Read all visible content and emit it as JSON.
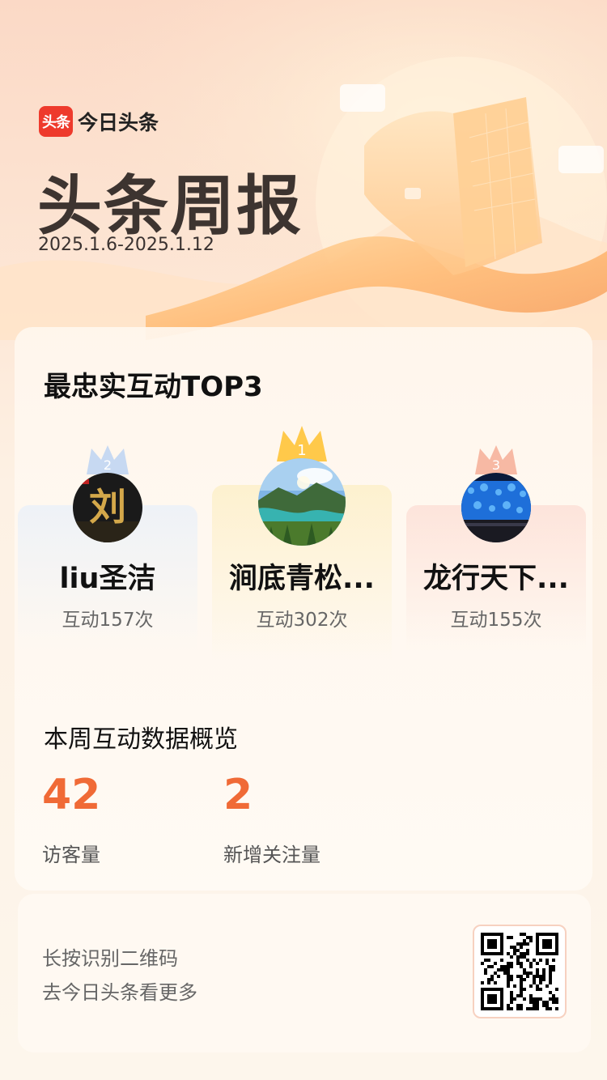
{
  "brand": {
    "badge_text": "头条",
    "app_name": "今日头条",
    "accent_color": "#ee3a2c"
  },
  "header": {
    "title": "头条周报",
    "date_range": "2025.1.6-2025.1.12"
  },
  "top_interactions": {
    "title": "最忠实互动TOP3",
    "ranks": [
      {
        "rank": "2",
        "name": "liu圣洁",
        "count_text": "互动157次",
        "avatar_char": "刘"
      },
      {
        "rank": "1",
        "name": "涧底青松...",
        "count_text": "互动302次"
      },
      {
        "rank": "3",
        "name": "龙行天下...",
        "count_text": "互动155次"
      }
    ]
  },
  "overview": {
    "title": "本周互动数据概览",
    "stats": [
      {
        "value": "42",
        "label": "访客量"
      },
      {
        "value": "2",
        "label": "新增关注量"
      }
    ],
    "value_color": "#f06a36"
  },
  "footer": {
    "line1": "长按识别二维码",
    "line2": "去今日头条看更多"
  }
}
